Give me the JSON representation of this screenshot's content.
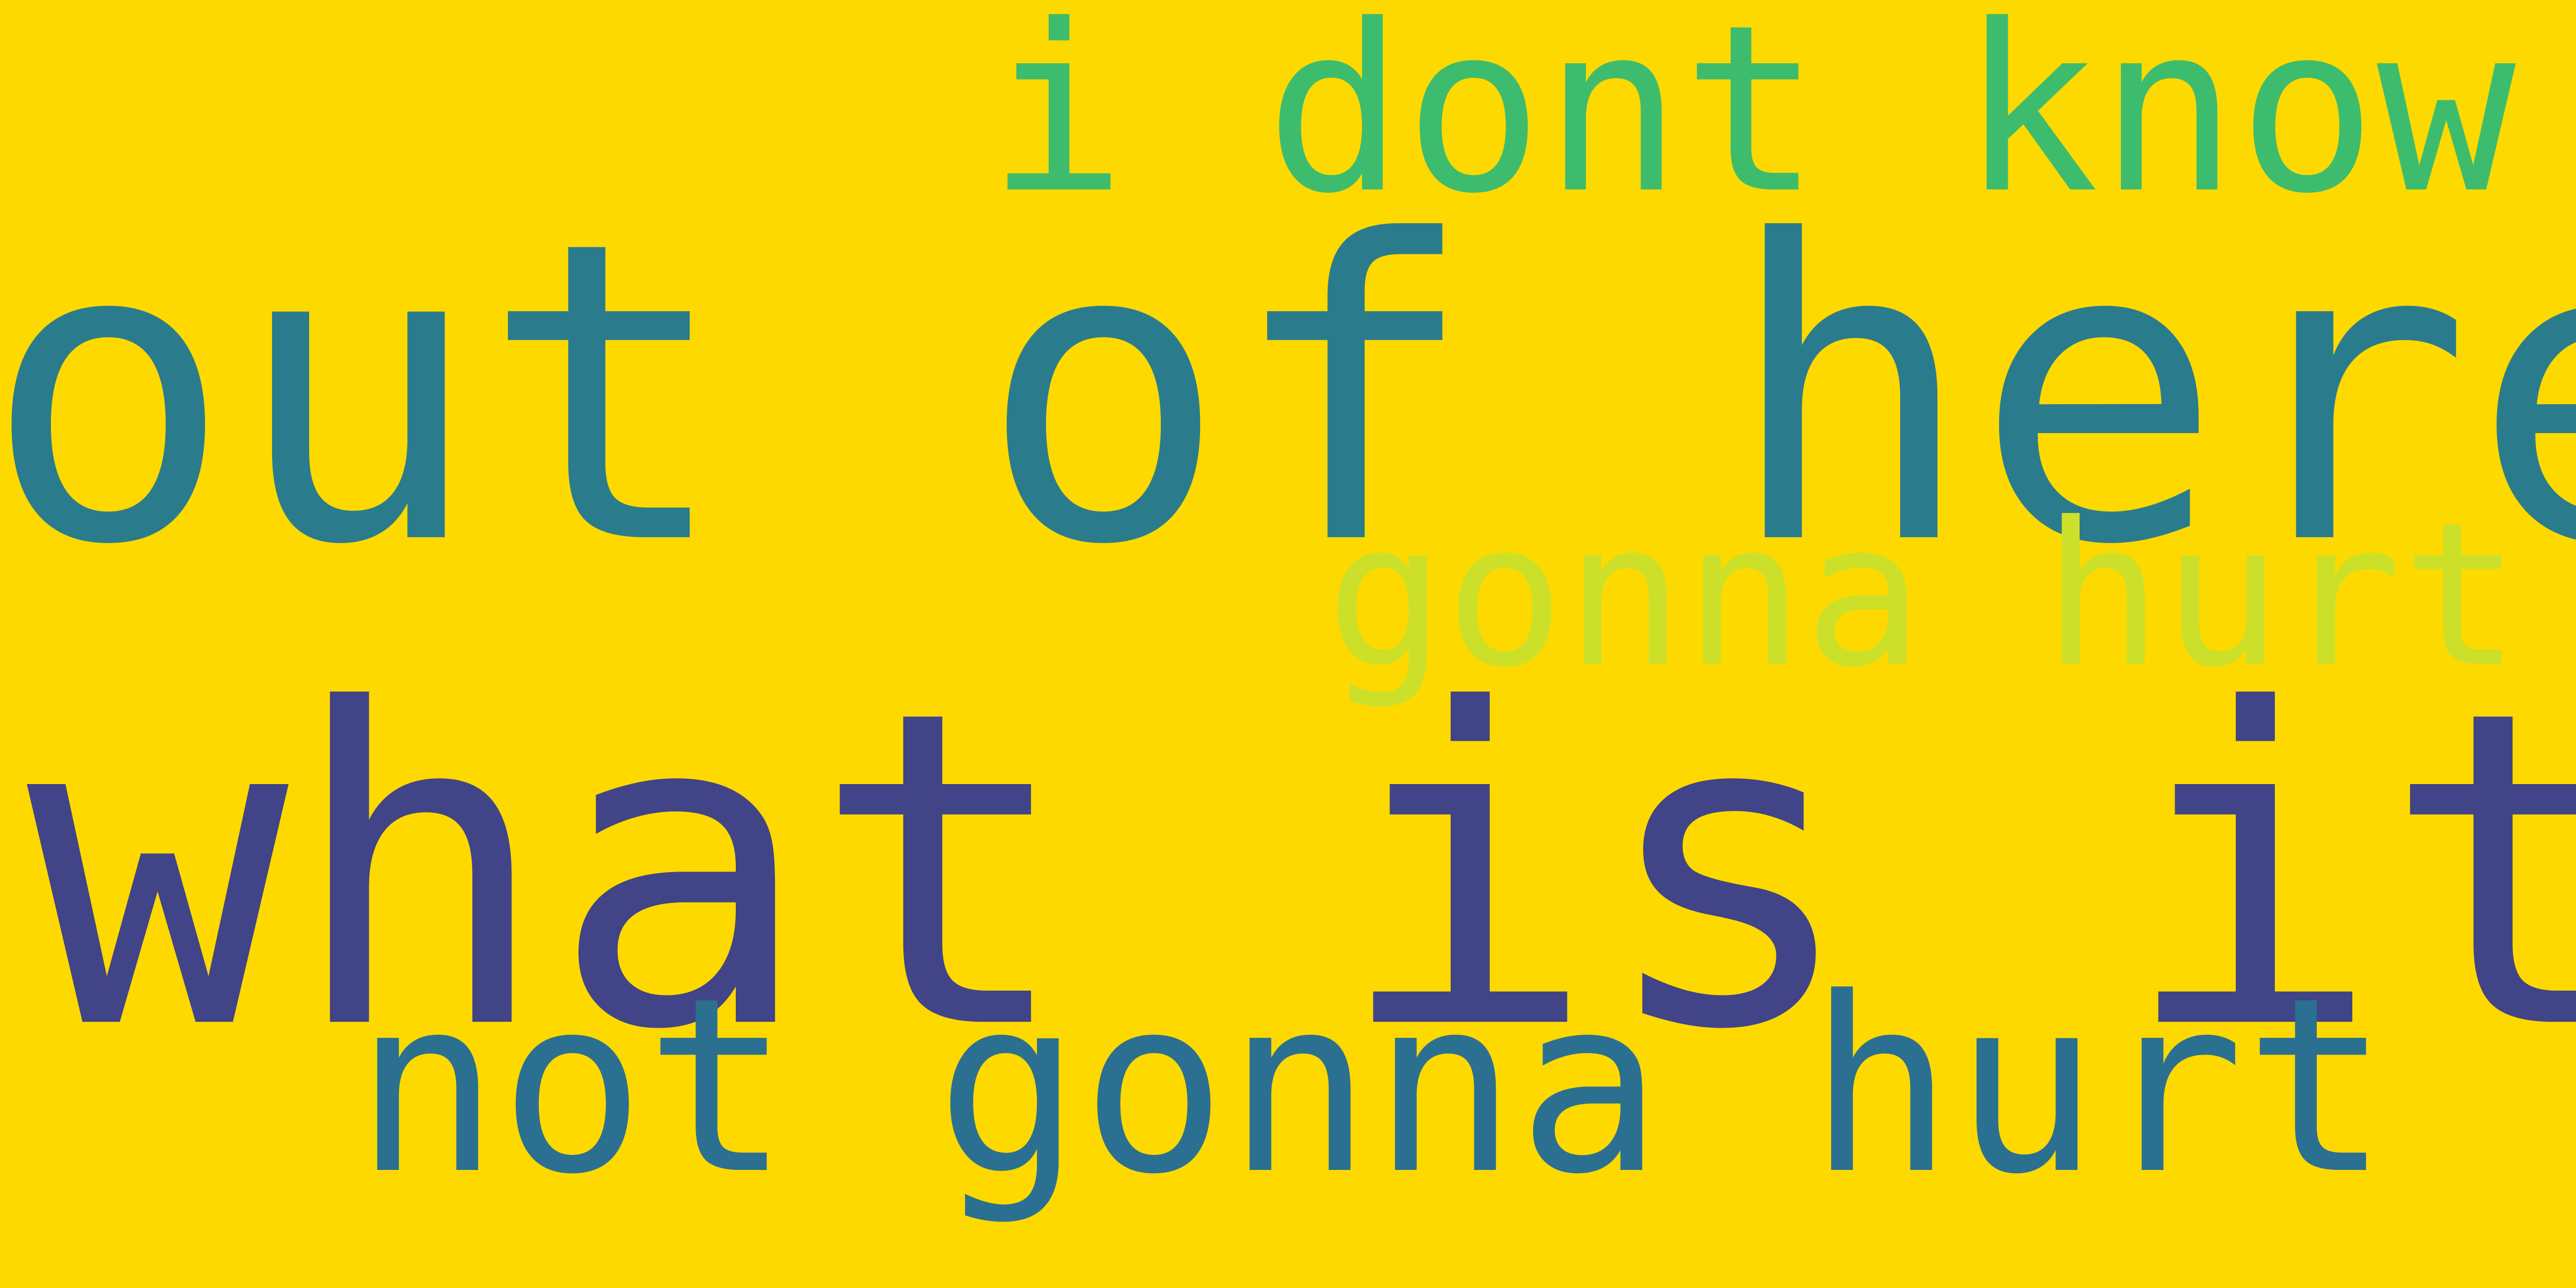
{
  "background_color": "#FDD900",
  "words": [
    {
      "text": "i dont know",
      "color": "#3DBC6E"
    },
    {
      "text": "out of here",
      "color": "#2A7C8C"
    },
    {
      "text": "gonna hurt you",
      "color": "#CCE02A"
    },
    {
      "text": "what is it",
      "color": "#414487"
    },
    {
      "text": "not gonna hurt",
      "color": "#2B7090"
    }
  ]
}
